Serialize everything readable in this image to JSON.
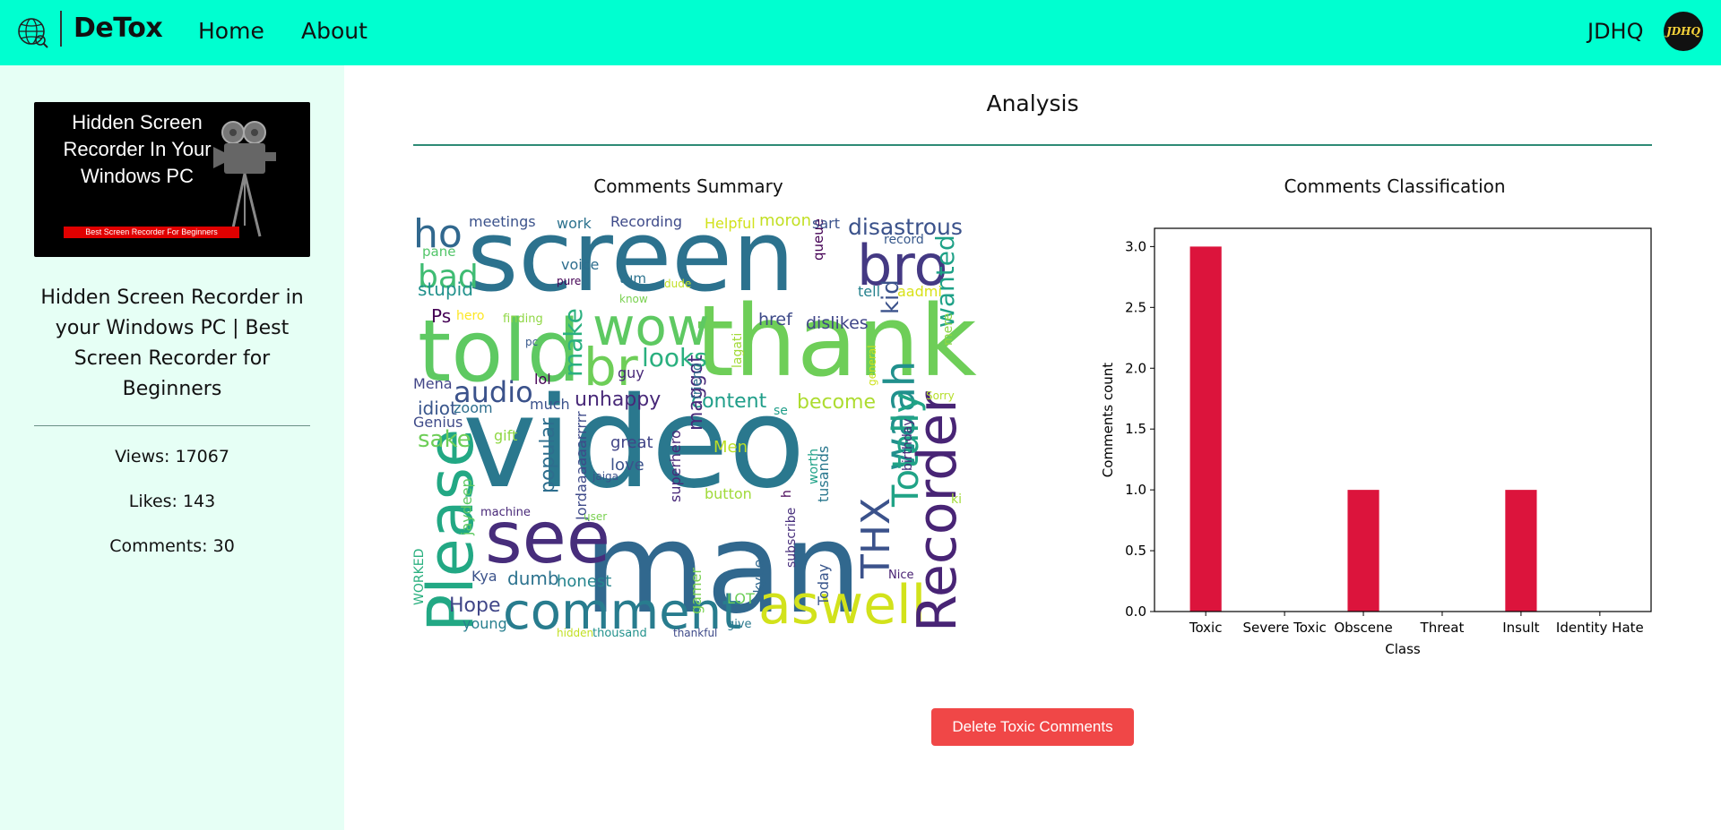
{
  "header": {
    "brand": "DeTox",
    "nav": {
      "home": "Home",
      "about": "About"
    },
    "username": "JDHQ",
    "avatar_text": "JDHQ",
    "background": "#00ffd0"
  },
  "sidebar": {
    "thumbnail": {
      "headline": "Hidden Screen Recorder In Your Windows PC",
      "banner": "Best Screen Recorder For Beginners"
    },
    "video_title": "Hidden Screen Recorder in your Windows PC | Best Screen Recorder for Beginners",
    "views": "Views: 17067",
    "likes": "Likes: 143",
    "comments": "Comments: 30",
    "background": "#e6fff5"
  },
  "main": {
    "heading": "Analysis",
    "wordcloud_title": "Comments Summary",
    "classification_title": "Comments Classification",
    "delete_button": "Delete Toxic Comments"
  },
  "wordcloud": {
    "words": [
      "video",
      "man",
      "screen",
      "thank",
      "see",
      "told",
      "comment",
      "aswell",
      "Recorder",
      "Please",
      "bro",
      "waah",
      "wow",
      "br",
      "ho",
      "THX",
      "disastrous",
      "bad",
      "audio",
      "Totally",
      "wanted",
      "looks",
      "make",
      "unhappy",
      "content",
      "become",
      "maggot",
      "superhero",
      "Jordaaaaaarrrrr",
      "popular",
      "great",
      "love",
      "dumb",
      "honest",
      "Hope",
      "young",
      "jaydeep",
      "sake",
      "idiot",
      "Mena",
      "Genius",
      "zoom",
      "much",
      "lol",
      "stupid",
      "Ps",
      "hero",
      "finding",
      "pc",
      "pane",
      "meetings",
      "work",
      "voice",
      "pure",
      "tum",
      "know",
      "dude",
      "queue",
      "Recording",
      "Helpful",
      "moron",
      "sart",
      "record",
      "tell",
      "aadmi",
      "href",
      "dislikes",
      "kid",
      "mere",
      "lagati",
      "guy",
      "friend",
      "general",
      "birthday",
      "Sorry",
      "se",
      "Men",
      "worth",
      "tusands",
      "button",
      "h",
      "subscribe",
      "Today",
      "Nice",
      "ki",
      "gamer",
      "skype",
      "LOT",
      "give",
      "thankful",
      "thousand",
      "hidden",
      "user",
      "machine",
      "gift",
      "WORKED",
      "Kya",
      "jaiga"
    ]
  },
  "chart_data": {
    "type": "bar",
    "title": "",
    "xlabel": "Class",
    "ylabel": "Comments count",
    "categories": [
      "Toxic",
      "Severe Toxic",
      "Obscene",
      "Threat",
      "Insult",
      "Identity Hate"
    ],
    "values": [
      3,
      0,
      1,
      0,
      1,
      0
    ],
    "ylim": [
      0,
      3.15
    ],
    "yticks": [
      "0.0",
      "0.5",
      "1.0",
      "1.5",
      "2.0",
      "2.5",
      "3.0"
    ],
    "bar_color": "#dc143c",
    "grid": false,
    "legend": "none"
  }
}
